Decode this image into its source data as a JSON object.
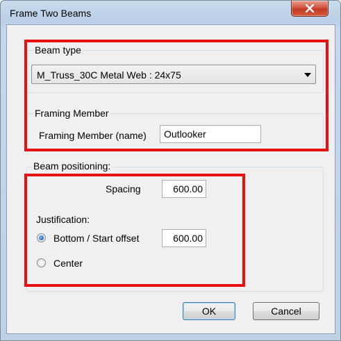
{
  "window": {
    "title": "Frame Two Beams"
  },
  "beam_type": {
    "label": "Beam type",
    "selected": "M_Truss_30C Metal Web : 24x75"
  },
  "framing_member": {
    "label": "Framing Member",
    "name_label": "Framing Member (name)",
    "name_value": "Outlooker"
  },
  "beam_positioning": {
    "label": "Beam positioning:",
    "spacing_label": "Spacing",
    "spacing_value": "600.00",
    "justification_label": "Justification:",
    "options": [
      {
        "label": "Bottom / Start offset",
        "value": "600.00",
        "checked": true
      },
      {
        "label": "Center",
        "checked": false
      }
    ]
  },
  "buttons": {
    "ok": "OK",
    "cancel": "Cancel"
  },
  "colors": {
    "highlight": "#e81010",
    "title_bar": "#bdd1e7",
    "close_button": "#c23a22"
  }
}
